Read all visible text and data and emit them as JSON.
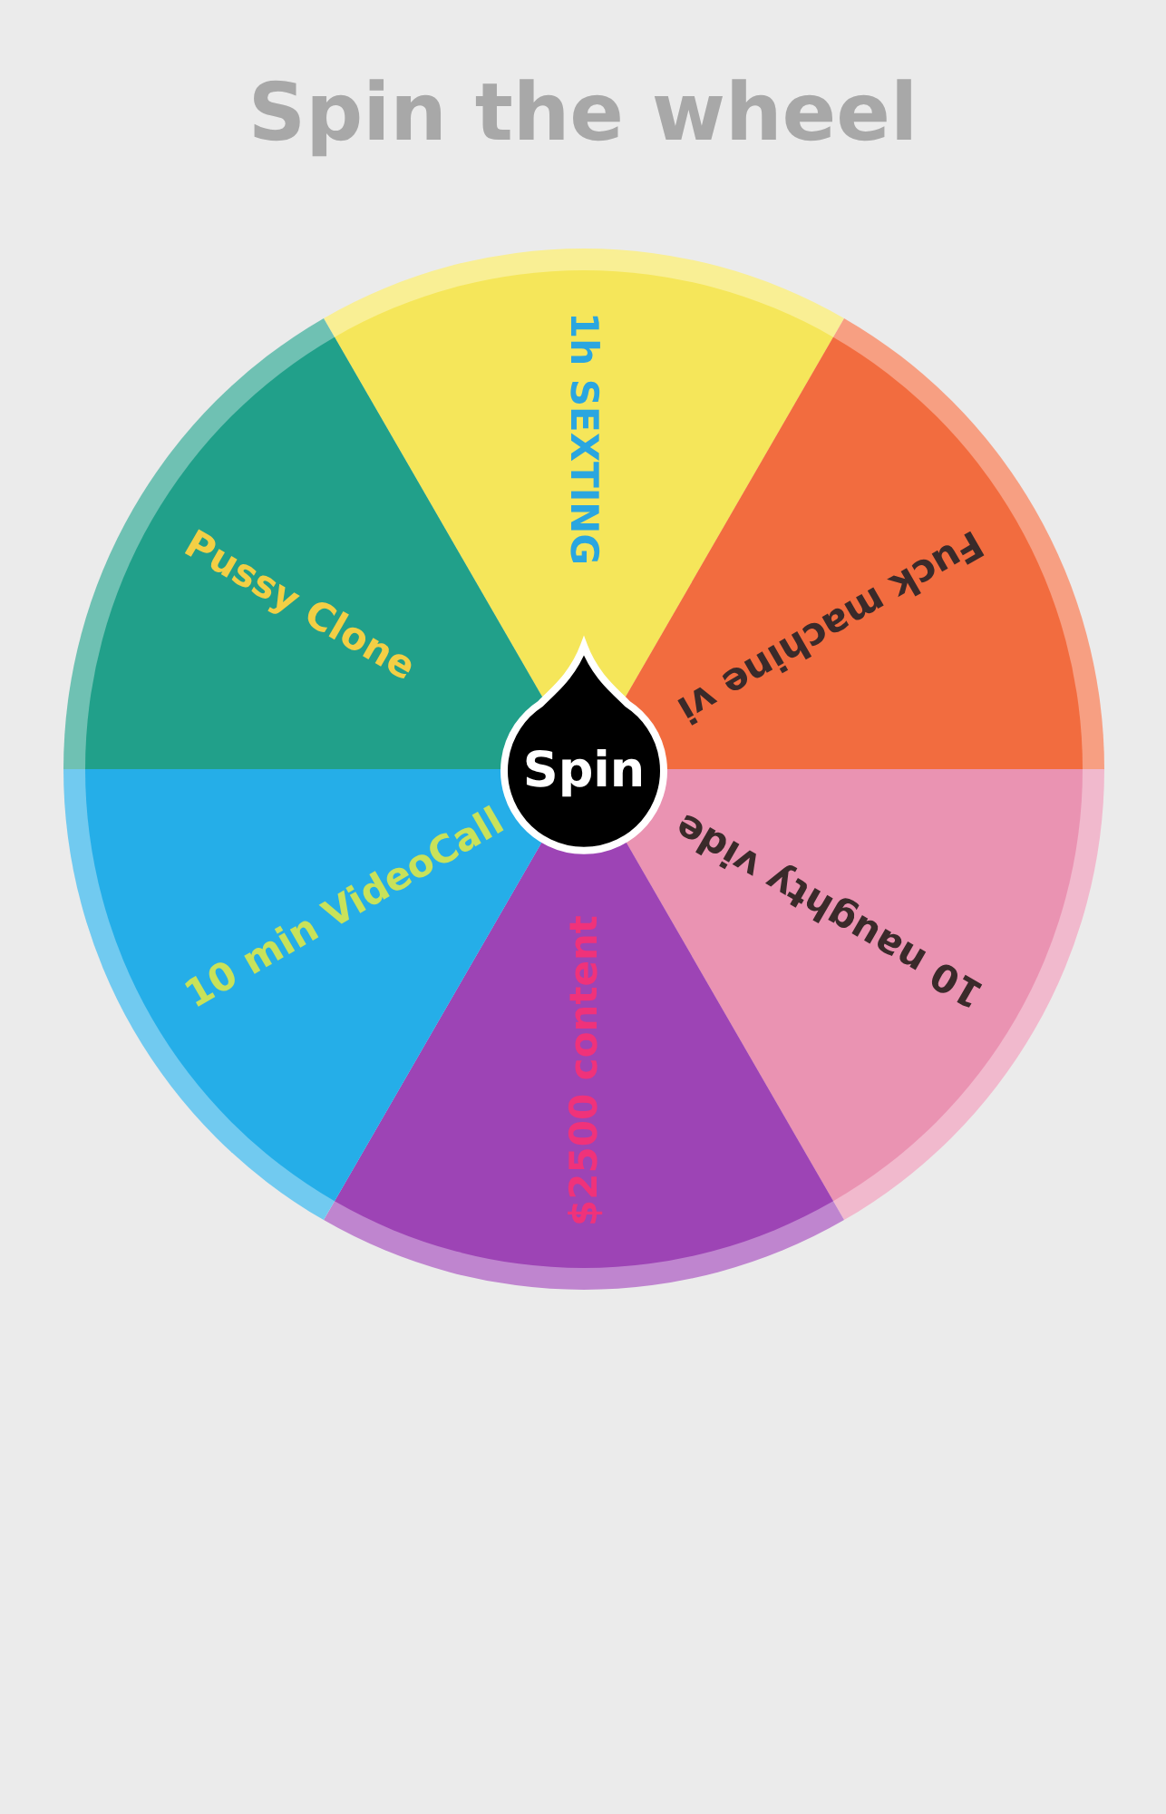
{
  "title": "Spin the wheel",
  "wheel": {
    "segments": [
      {
        "label": "1h SEXTING",
        "color": "#f5e65a"
      },
      {
        "label": "Fuck machine vi",
        "color": "#f26c3f"
      },
      {
        "label": "10 naughty vide",
        "color": "#ea93b2"
      },
      {
        "label": "$2500 content",
        "color": "#9d44b5"
      },
      {
        "label": "10 min VideoCall",
        "color": "#25aee8"
      },
      {
        "label": "Pussy Clone",
        "color": "#21a08a"
      }
    ]
  },
  "spin_button": {
    "label": "Spin"
  }
}
